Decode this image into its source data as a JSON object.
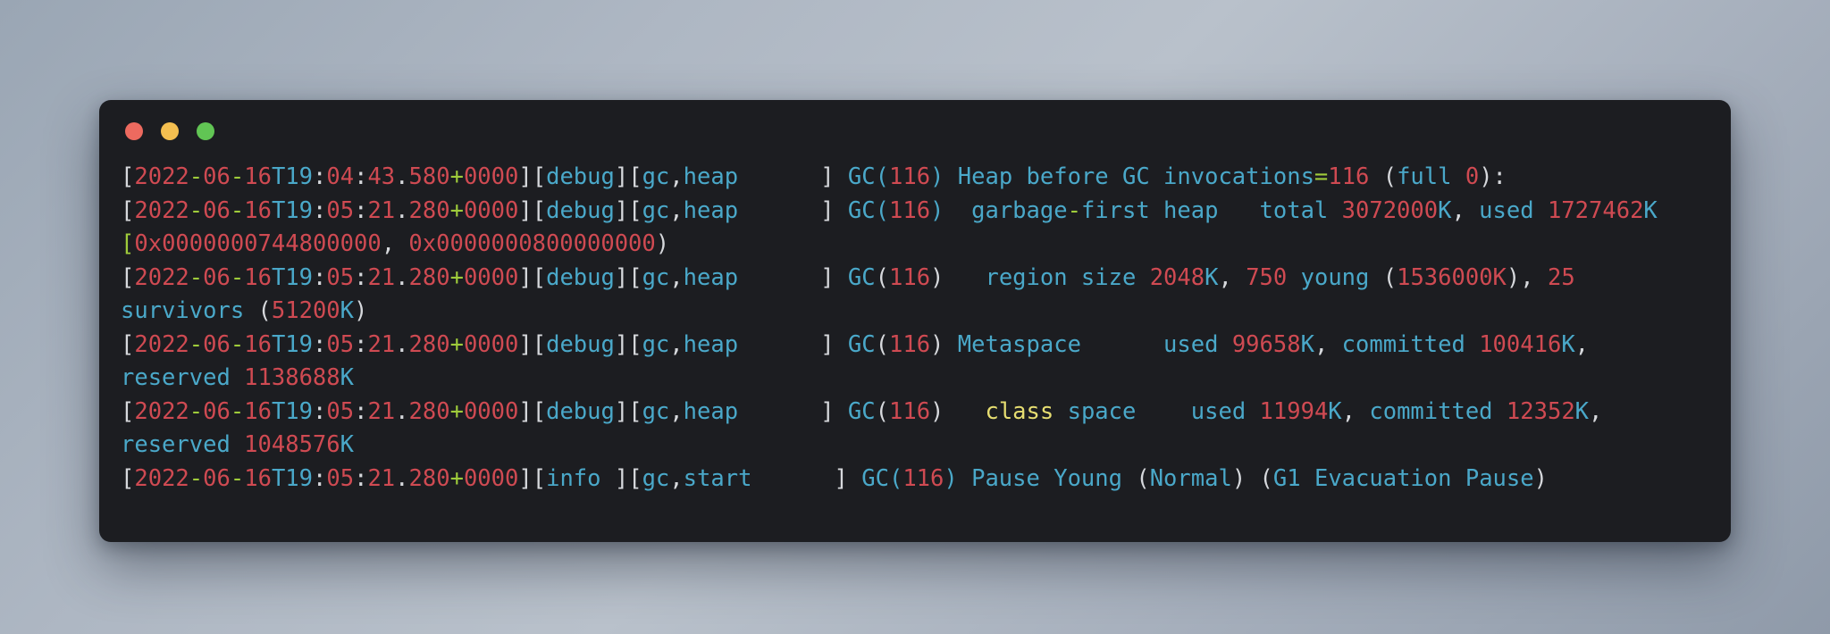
{
  "window": {
    "title": "terminal",
    "controls": [
      {
        "name": "close",
        "color": "#ed6a5f"
      },
      {
        "name": "minimize",
        "color": "#f4bf50"
      },
      {
        "name": "zoom",
        "color": "#61c554"
      }
    ]
  },
  "terminal": {
    "background": "#1c1d21",
    "palette": {
      "punctuation": "#d6d8dc",
      "number": "#cf4a52",
      "separator": "#9fcc3b",
      "identifier": "#4aa8c9",
      "keyword": "#e6dd71"
    },
    "lines": [
      {
        "id": "log-line-1",
        "plain": "[2022-06-16T19:04:43.580+0000][debug][gc,heap      ] GC(116) Heap before GC invocations=116 (full 0):",
        "tokens": [
          {
            "t": "[",
            "c": "w"
          },
          {
            "t": "2022",
            "c": "r"
          },
          {
            "t": "-",
            "c": "g"
          },
          {
            "t": "06",
            "c": "r"
          },
          {
            "t": "-",
            "c": "g"
          },
          {
            "t": "16",
            "c": "r"
          },
          {
            "t": "T",
            "c": "c"
          },
          {
            "t": "19",
            "c": "c"
          },
          {
            "t": ":",
            "c": "w"
          },
          {
            "t": "04",
            "c": "r"
          },
          {
            "t": ":",
            "c": "w"
          },
          {
            "t": "43",
            "c": "r"
          },
          {
            "t": ".",
            "c": "w"
          },
          {
            "t": "580",
            "c": "r"
          },
          {
            "t": "+",
            "c": "g"
          },
          {
            "t": "0000",
            "c": "r"
          },
          {
            "t": "][",
            "c": "w"
          },
          {
            "t": "debug",
            "c": "c"
          },
          {
            "t": "][",
            "c": "w"
          },
          {
            "t": "gc",
            "c": "c"
          },
          {
            "t": ",",
            "c": "w"
          },
          {
            "t": "heap",
            "c": "c"
          },
          {
            "t": "      ] ",
            "c": "w"
          },
          {
            "t": "GC",
            "c": "c"
          },
          {
            "t": "(",
            "c": "c"
          },
          {
            "t": "116",
            "c": "r"
          },
          {
            "t": ")",
            "c": "c"
          },
          {
            "t": " Heap before GC invocations",
            "c": "c"
          },
          {
            "t": "=",
            "c": "g"
          },
          {
            "t": "116",
            "c": "r"
          },
          {
            "t": " (",
            "c": "w"
          },
          {
            "t": "full",
            "c": "c"
          },
          {
            "t": " ",
            "c": "w"
          },
          {
            "t": "0",
            "c": "r"
          },
          {
            "t": "):",
            "c": "w"
          }
        ]
      },
      {
        "id": "log-line-2",
        "plain": "[2022-06-16T19:05:21.280+0000][debug][gc,heap      ] GC(116)  garbage-first heap   total 3072000K, used 1727462K [0x0000000744800000, 0x0000000800000000)",
        "tokens": [
          {
            "t": "[",
            "c": "w"
          },
          {
            "t": "2022",
            "c": "r"
          },
          {
            "t": "-",
            "c": "g"
          },
          {
            "t": "06",
            "c": "r"
          },
          {
            "t": "-",
            "c": "g"
          },
          {
            "t": "16",
            "c": "r"
          },
          {
            "t": "T",
            "c": "c"
          },
          {
            "t": "19",
            "c": "c"
          },
          {
            "t": ":",
            "c": "w"
          },
          {
            "t": "05",
            "c": "r"
          },
          {
            "t": ":",
            "c": "w"
          },
          {
            "t": "21",
            "c": "r"
          },
          {
            "t": ".",
            "c": "w"
          },
          {
            "t": "280",
            "c": "r"
          },
          {
            "t": "+",
            "c": "g"
          },
          {
            "t": "0000",
            "c": "r"
          },
          {
            "t": "][",
            "c": "w"
          },
          {
            "t": "debug",
            "c": "c"
          },
          {
            "t": "][",
            "c": "w"
          },
          {
            "t": "gc",
            "c": "c"
          },
          {
            "t": ",",
            "c": "w"
          },
          {
            "t": "heap",
            "c": "c"
          },
          {
            "t": "      ] ",
            "c": "w"
          },
          {
            "t": "GC",
            "c": "c"
          },
          {
            "t": "(",
            "c": "c"
          },
          {
            "t": "116",
            "c": "r"
          },
          {
            "t": ")",
            "c": "c"
          },
          {
            "t": "  garbage",
            "c": "c"
          },
          {
            "t": "-",
            "c": "g"
          },
          {
            "t": "first heap   total ",
            "c": "c"
          },
          {
            "t": "3072000",
            "c": "r"
          },
          {
            "t": "K",
            "c": "c"
          },
          {
            "t": ",",
            "c": "w"
          },
          {
            "t": " used ",
            "c": "c"
          },
          {
            "t": "1727462",
            "c": "r"
          },
          {
            "t": "K",
            "c": "c"
          },
          {
            "t": " ",
            "c": "w"
          },
          {
            "t": "[",
            "c": "g"
          },
          {
            "t": "0x0000000744800000",
            "c": "r"
          },
          {
            "t": ",",
            "c": "w"
          },
          {
            "t": " ",
            "c": "w"
          },
          {
            "t": "0x0000000800000000",
            "c": "r"
          },
          {
            "t": ")",
            "c": "w"
          }
        ]
      },
      {
        "id": "log-line-3",
        "plain": "[2022-06-16T19:05:21.280+0000][debug][gc,heap      ] GC(116)   region size 2048K, 750 young (1536000K), 25 survivors (51200K)",
        "tokens": [
          {
            "t": "[",
            "c": "w"
          },
          {
            "t": "2022",
            "c": "r"
          },
          {
            "t": "-",
            "c": "g"
          },
          {
            "t": "06",
            "c": "r"
          },
          {
            "t": "-",
            "c": "g"
          },
          {
            "t": "16",
            "c": "r"
          },
          {
            "t": "T",
            "c": "c"
          },
          {
            "t": "19",
            "c": "c"
          },
          {
            "t": ":",
            "c": "w"
          },
          {
            "t": "05",
            "c": "r"
          },
          {
            "t": ":",
            "c": "w"
          },
          {
            "t": "21",
            "c": "r"
          },
          {
            "t": ".",
            "c": "w"
          },
          {
            "t": "280",
            "c": "r"
          },
          {
            "t": "+",
            "c": "g"
          },
          {
            "t": "0000",
            "c": "r"
          },
          {
            "t": "][",
            "c": "w"
          },
          {
            "t": "debug",
            "c": "c"
          },
          {
            "t": "][",
            "c": "w"
          },
          {
            "t": "gc",
            "c": "c"
          },
          {
            "t": ",",
            "c": "w"
          },
          {
            "t": "heap",
            "c": "c"
          },
          {
            "t": "      ] ",
            "c": "w"
          },
          {
            "t": "GC",
            "c": "c"
          },
          {
            "t": "(",
            "c": "w"
          },
          {
            "t": "116",
            "c": "r"
          },
          {
            "t": ")",
            "c": "w"
          },
          {
            "t": "   region size ",
            "c": "c"
          },
          {
            "t": "2048",
            "c": "r"
          },
          {
            "t": "K",
            "c": "c"
          },
          {
            "t": ",",
            "c": "w"
          },
          {
            "t": " ",
            "c": "w"
          },
          {
            "t": "750",
            "c": "r"
          },
          {
            "t": " young ",
            "c": "c"
          },
          {
            "t": "(",
            "c": "w"
          },
          {
            "t": "1536000K",
            "c": "r"
          },
          {
            "t": ")",
            "c": "w"
          },
          {
            "t": ",",
            "c": "w"
          },
          {
            "t": " ",
            "c": "w"
          },
          {
            "t": "25",
            "c": "r"
          },
          {
            "t": " survivors ",
            "c": "c"
          },
          {
            "t": "(",
            "c": "w"
          },
          {
            "t": "51200",
            "c": "r"
          },
          {
            "t": "K",
            "c": "c"
          },
          {
            "t": ")",
            "c": "w"
          }
        ]
      },
      {
        "id": "log-line-4",
        "plain": "[2022-06-16T19:05:21.280+0000][debug][gc,heap      ] GC(116)  Metaspace      used 99658K, committed 100416K, reserved 1138688K",
        "tokens": [
          {
            "t": "[",
            "c": "w"
          },
          {
            "t": "2022",
            "c": "r"
          },
          {
            "t": "-",
            "c": "g"
          },
          {
            "t": "06",
            "c": "r"
          },
          {
            "t": "-",
            "c": "g"
          },
          {
            "t": "16",
            "c": "r"
          },
          {
            "t": "T",
            "c": "c"
          },
          {
            "t": "19",
            "c": "c"
          },
          {
            "t": ":",
            "c": "w"
          },
          {
            "t": "05",
            "c": "r"
          },
          {
            "t": ":",
            "c": "w"
          },
          {
            "t": "21",
            "c": "r"
          },
          {
            "t": ".",
            "c": "w"
          },
          {
            "t": "280",
            "c": "r"
          },
          {
            "t": "+",
            "c": "g"
          },
          {
            "t": "0000",
            "c": "r"
          },
          {
            "t": "][",
            "c": "w"
          },
          {
            "t": "debug",
            "c": "c"
          },
          {
            "t": "][",
            "c": "w"
          },
          {
            "t": "gc",
            "c": "c"
          },
          {
            "t": ",",
            "c": "w"
          },
          {
            "t": "heap",
            "c": "c"
          },
          {
            "t": "      ] ",
            "c": "w"
          },
          {
            "t": "GC",
            "c": "c"
          },
          {
            "t": "(",
            "c": "w"
          },
          {
            "t": "116",
            "c": "r"
          },
          {
            "t": ")",
            "c": "w"
          },
          {
            "t": " Metaspace      used ",
            "c": "c"
          },
          {
            "t": "99658",
            "c": "r"
          },
          {
            "t": "K",
            "c": "c"
          },
          {
            "t": ",",
            "c": "w"
          },
          {
            "t": " committed ",
            "c": "c"
          },
          {
            "t": "100416",
            "c": "r"
          },
          {
            "t": "K",
            "c": "c"
          },
          {
            "t": ",",
            "c": "w"
          },
          {
            "t": " reserved ",
            "c": "c"
          },
          {
            "t": "1138688",
            "c": "r"
          },
          {
            "t": "K",
            "c": "c"
          }
        ]
      },
      {
        "id": "log-line-5",
        "plain": "[2022-06-16T19:05:21.280+0000][debug][gc,heap      ] GC(116)   class space    used 11994K, committed 12352K, reserved 1048576K",
        "tokens": [
          {
            "t": "[",
            "c": "w"
          },
          {
            "t": "2022",
            "c": "r"
          },
          {
            "t": "-",
            "c": "g"
          },
          {
            "t": "06",
            "c": "r"
          },
          {
            "t": "-",
            "c": "g"
          },
          {
            "t": "16",
            "c": "r"
          },
          {
            "t": "T",
            "c": "c"
          },
          {
            "t": "19",
            "c": "c"
          },
          {
            "t": ":",
            "c": "w"
          },
          {
            "t": "05",
            "c": "r"
          },
          {
            "t": ":",
            "c": "w"
          },
          {
            "t": "21",
            "c": "r"
          },
          {
            "t": ".",
            "c": "w"
          },
          {
            "t": "280",
            "c": "r"
          },
          {
            "t": "+",
            "c": "g"
          },
          {
            "t": "0000",
            "c": "r"
          },
          {
            "t": "][",
            "c": "w"
          },
          {
            "t": "debug",
            "c": "c"
          },
          {
            "t": "][",
            "c": "w"
          },
          {
            "t": "gc",
            "c": "c"
          },
          {
            "t": ",",
            "c": "w"
          },
          {
            "t": "heap",
            "c": "c"
          },
          {
            "t": "      ] ",
            "c": "w"
          },
          {
            "t": "GC",
            "c": "c"
          },
          {
            "t": "(",
            "c": "w"
          },
          {
            "t": "116",
            "c": "r"
          },
          {
            "t": ")",
            "c": "w"
          },
          {
            "t": "   ",
            "c": "w"
          },
          {
            "t": "class",
            "c": "y"
          },
          {
            "t": " space    used ",
            "c": "c"
          },
          {
            "t": "11994",
            "c": "r"
          },
          {
            "t": "K",
            "c": "c"
          },
          {
            "t": ",",
            "c": "w"
          },
          {
            "t": " committed ",
            "c": "c"
          },
          {
            "t": "12352",
            "c": "r"
          },
          {
            "t": "K",
            "c": "c"
          },
          {
            "t": ",",
            "c": "w"
          },
          {
            "t": " reserved ",
            "c": "c"
          },
          {
            "t": "1048576",
            "c": "r"
          },
          {
            "t": "K",
            "c": "c"
          }
        ]
      },
      {
        "id": "log-line-6",
        "plain": "[2022-06-16T19:05:21.280+0000][info ][gc,start      ] GC(116) Pause Young (Normal) (G1 Evacuation Pause)",
        "tokens": [
          {
            "t": "[",
            "c": "w"
          },
          {
            "t": "2022",
            "c": "r"
          },
          {
            "t": "-",
            "c": "g"
          },
          {
            "t": "06",
            "c": "r"
          },
          {
            "t": "-",
            "c": "g"
          },
          {
            "t": "16",
            "c": "r"
          },
          {
            "t": "T",
            "c": "c"
          },
          {
            "t": "19",
            "c": "c"
          },
          {
            "t": ":",
            "c": "w"
          },
          {
            "t": "05",
            "c": "r"
          },
          {
            "t": ":",
            "c": "w"
          },
          {
            "t": "21",
            "c": "r"
          },
          {
            "t": ".",
            "c": "w"
          },
          {
            "t": "280",
            "c": "r"
          },
          {
            "t": "+",
            "c": "g"
          },
          {
            "t": "0000",
            "c": "r"
          },
          {
            "t": "][",
            "c": "w"
          },
          {
            "t": "info",
            "c": "c"
          },
          {
            "t": " ][",
            "c": "w"
          },
          {
            "t": "gc",
            "c": "c"
          },
          {
            "t": ",",
            "c": "w"
          },
          {
            "t": "start",
            "c": "c"
          },
          {
            "t": "      ] ",
            "c": "w"
          },
          {
            "t": "GC",
            "c": "c"
          },
          {
            "t": "(",
            "c": "c"
          },
          {
            "t": "116",
            "c": "r"
          },
          {
            "t": ")",
            "c": "c"
          },
          {
            "t": " Pause Young ",
            "c": "c"
          },
          {
            "t": "(",
            "c": "w"
          },
          {
            "t": "Normal",
            "c": "c"
          },
          {
            "t": ")",
            "c": "w"
          },
          {
            "t": " ",
            "c": "w"
          },
          {
            "t": "(",
            "c": "w"
          },
          {
            "t": "G1 Evacuation Pause",
            "c": "c"
          },
          {
            "t": ")",
            "c": "w"
          }
        ]
      }
    ]
  }
}
